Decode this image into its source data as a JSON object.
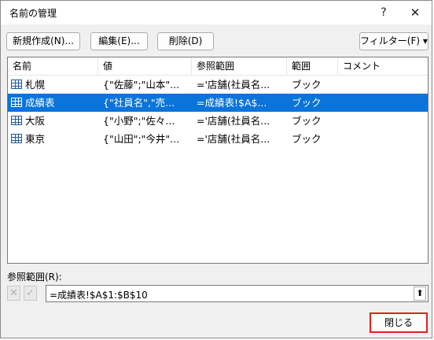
{
  "window": {
    "title": "名前の管理",
    "help_glyph": "?",
    "close_glyph": "✕"
  },
  "toolbar": {
    "new_label": "新規作成(N)...",
    "edit_label": "編集(E)...",
    "delete_label": "削除(D)",
    "filter_label": "フィルター(F)",
    "filter_arrow": "▾"
  },
  "columns": [
    "名前",
    "値",
    "参照範囲",
    "範囲",
    "コメント"
  ],
  "rows": [
    {
      "name": "札幌",
      "value": "{\"佐藤\";\"山本\"...",
      "refers_to": "='店舗(社員名...",
      "scope": "ブック",
      "comment": "",
      "selected": false
    },
    {
      "name": "成績表",
      "value": "{\"社員名\",\"売...",
      "refers_to": "=成績表!$A$...",
      "scope": "ブック",
      "comment": "",
      "selected": true
    },
    {
      "name": "大阪",
      "value": "{\"小野\";\"佐々...",
      "refers_to": "='店舗(社員名...",
      "scope": "ブック",
      "comment": "",
      "selected": false
    },
    {
      "name": "東京",
      "value": "{\"山田\";\"今井\"...",
      "refers_to": "='店舗(社員名...",
      "scope": "ブック",
      "comment": "",
      "selected": false
    }
  ],
  "reference": {
    "label": "参照範囲(R):",
    "value": "=成績表!$A$1:$B$10",
    "cancel_glyph": "✕",
    "ok_glyph": "✓",
    "collapse_glyph": "⬆"
  },
  "footer": {
    "close_label": "閉じる"
  },
  "colors": {
    "selection": "#0a74da",
    "highlight_border": "#e02020"
  }
}
